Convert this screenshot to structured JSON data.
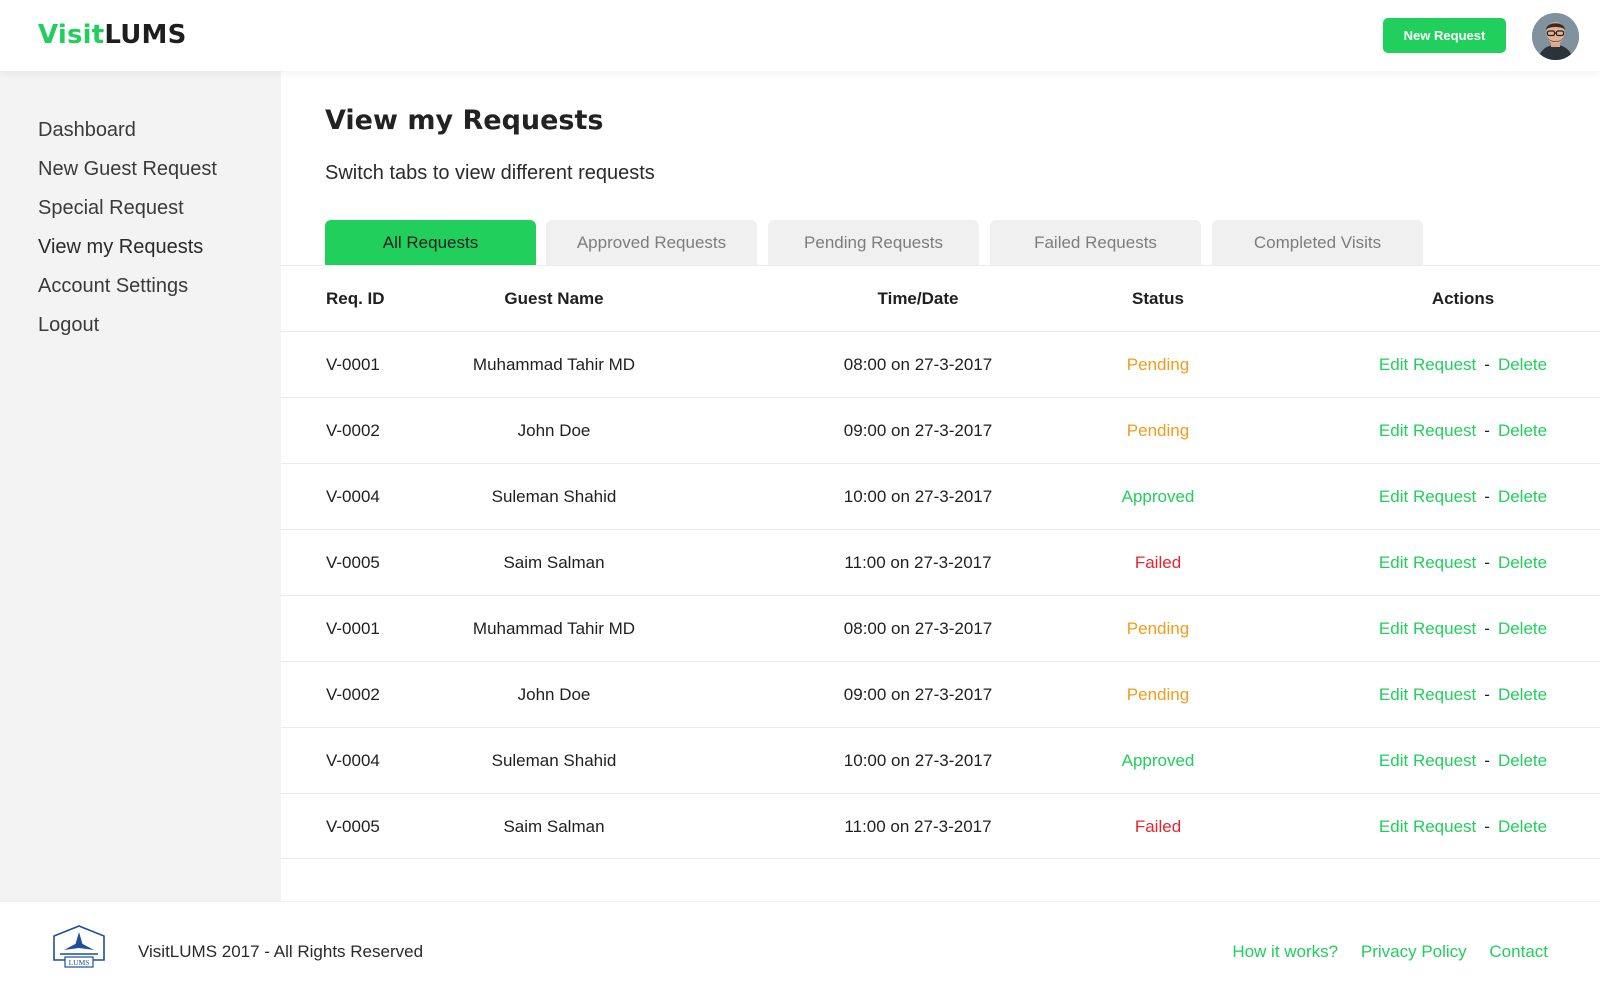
{
  "header": {
    "logo_part1": "Visit",
    "logo_part2": "LUMS",
    "new_request_label": "New Request",
    "avatar_icon": "user-avatar"
  },
  "sidebar": {
    "items": [
      {
        "label": "Dashboard",
        "active": false
      },
      {
        "label": "New Guest Request",
        "active": false
      },
      {
        "label": "Special Request",
        "active": false
      },
      {
        "label": "View my Requests",
        "active": true
      },
      {
        "label": "Account Settings",
        "active": false
      },
      {
        "label": "Logout",
        "active": false
      }
    ]
  },
  "main": {
    "title": "View my Requests",
    "subtitle": "Switch tabs to view different requests",
    "tabs": [
      {
        "label": "All Requests",
        "active": true
      },
      {
        "label": "Approved Requests",
        "active": false
      },
      {
        "label": "Pending Requests",
        "active": false
      },
      {
        "label": "Failed Requests",
        "active": false
      },
      {
        "label": "Completed Visits",
        "active": false
      }
    ],
    "table": {
      "columns": [
        "Req. ID",
        "Guest Name",
        "Time/Date",
        "Status",
        "Actions"
      ],
      "rows": [
        {
          "id": "V-0001",
          "name": "Muhammad Tahir MD",
          "time": "08:00 on 27-3-2017",
          "status": "Pending",
          "edit": "Edit Request",
          "sep": "-",
          "delete": "Delete"
        },
        {
          "id": "V-0002",
          "name": "John Doe",
          "time": "09:00 on 27-3-2017",
          "status": "Pending",
          "edit": "Edit Request",
          "sep": "-",
          "delete": "Delete"
        },
        {
          "id": "V-0004",
          "name": "Suleman Shahid",
          "time": "10:00 on 27-3-2017",
          "status": "Approved",
          "edit": "Edit Request",
          "sep": "-",
          "delete": "Delete"
        },
        {
          "id": "V-0005",
          "name": "Saim Salman",
          "time": "11:00 on 27-3-2017",
          "status": "Failed",
          "edit": "Edit Request",
          "sep": "-",
          "delete": "Delete"
        },
        {
          "id": "V-0001",
          "name": "Muhammad Tahir MD",
          "time": "08:00 on 27-3-2017",
          "status": "Pending",
          "edit": "Edit Request",
          "sep": "-",
          "delete": "Delete"
        },
        {
          "id": "V-0002",
          "name": "John Doe",
          "time": "09:00 on 27-3-2017",
          "status": "Pending",
          "edit": "Edit Request",
          "sep": "-",
          "delete": "Delete"
        },
        {
          "id": "V-0004",
          "name": "Suleman Shahid",
          "time": "10:00 on 27-3-2017",
          "status": "Approved",
          "edit": "Edit Request",
          "sep": "-",
          "delete": "Delete"
        },
        {
          "id": "V-0005",
          "name": "Saim Salman",
          "time": "11:00 on 27-3-2017",
          "status": "Failed",
          "edit": "Edit Request",
          "sep": "-",
          "delete": "Delete"
        }
      ]
    }
  },
  "footer": {
    "logo_text": "LUMS",
    "copyright": "VisitLUMS 2017 - All Rights Reserved",
    "links": [
      "How it works?",
      "Privacy Policy",
      "Contact"
    ]
  },
  "colors": {
    "accent": "#21cf5c",
    "pending": "#f39c1b",
    "approved": "#21cf5c",
    "failed": "#e8232f",
    "sidebar_bg": "#f3f3f3"
  }
}
